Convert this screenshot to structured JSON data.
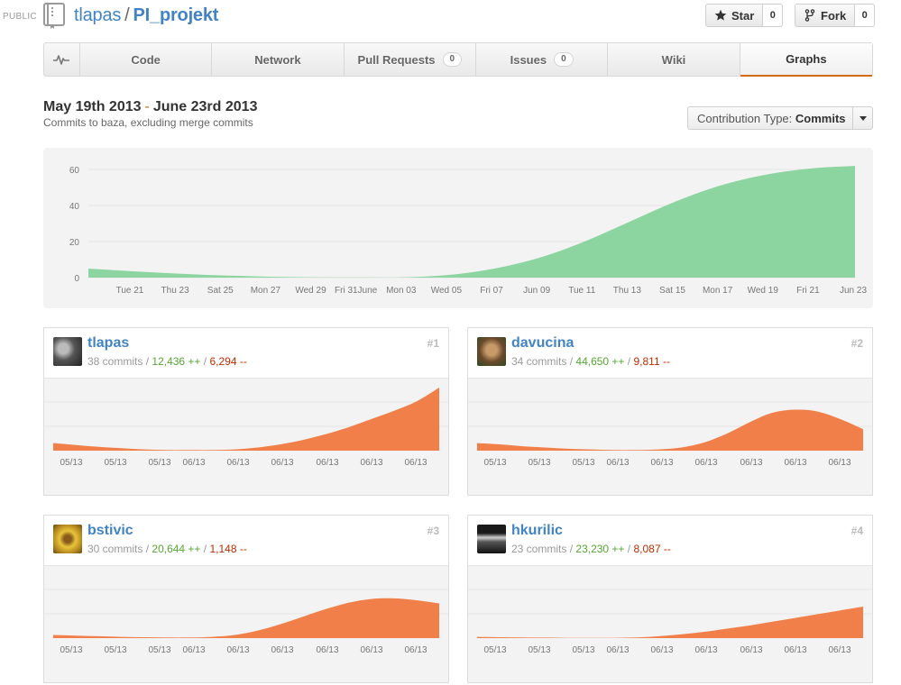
{
  "header": {
    "visibility": "PUBLIC",
    "owner": "tlapas",
    "separator": "/",
    "repo": "PI_projekt",
    "star_label": "Star",
    "star_count": "0",
    "fork_label": "Fork",
    "fork_count": "0"
  },
  "tabs": [
    {
      "label": "",
      "icon": "pulse-icon"
    },
    {
      "label": "Code"
    },
    {
      "label": "Network"
    },
    {
      "label": "Pull Requests",
      "count": "0"
    },
    {
      "label": "Issues",
      "count": "0"
    },
    {
      "label": "Wiki"
    },
    {
      "label": "Graphs",
      "active": true
    }
  ],
  "range": {
    "start": "May 19th 2013",
    "dash": "-",
    "end": "June 23rd 2013",
    "subtitle": "Commits to baza, excluding merge commits"
  },
  "contribution_type": {
    "label": "Contribution Type:",
    "value": "Commits"
  },
  "colors": {
    "main_area": "#8dd5a0",
    "contrib_area": "#f17f49",
    "link": "#4183c4",
    "additions": "#55a532",
    "deletions": "#bd2c00",
    "active_tab_border": "#d26911"
  },
  "chart_data": [
    {
      "type": "area",
      "yticks": [
        0,
        20,
        40,
        60
      ],
      "ylim": [
        0,
        62
      ],
      "xticks": [
        "Tue 21",
        "Thu 23",
        "Sat 25",
        "Mon 27",
        "Wed 29",
        "Fri 31June",
        "Mon 03",
        "Wed 05",
        "Fri 07",
        "Jun 09",
        "Tue 11",
        "Thu 13",
        "Sat 15",
        "Mon 17",
        "Wed 19",
        "Fri 21",
        "Jun 23"
      ],
      "x": [
        0,
        2,
        4,
        6,
        8,
        10,
        12,
        14,
        16,
        18,
        20,
        22,
        24,
        26,
        28,
        30,
        32,
        34
      ],
      "values": [
        5,
        3.5,
        2.2,
        1.2,
        0.5,
        0.2,
        0.1,
        0.2,
        1.5,
        5,
        11,
        20,
        31,
        42,
        51,
        57,
        60.5,
        62
      ]
    },
    {
      "type": "area",
      "contributor": "tlapas",
      "xticks": [
        "05/13",
        "05/13",
        "05/13",
        "06/13",
        "06/13",
        "06/13",
        "06/13",
        "06/13",
        "06/13"
      ],
      "values": [
        0.12,
        0.09,
        0.06,
        0.04,
        0.02,
        0.01,
        0.01,
        0.01,
        0.02,
        0.05,
        0.1,
        0.17,
        0.26,
        0.37,
        0.5,
        0.63,
        0.78,
        1.0
      ]
    },
    {
      "type": "area",
      "contributor": "davucina",
      "xticks": [
        "05/13",
        "05/13",
        "05/13",
        "06/13",
        "06/13",
        "06/13",
        "06/13",
        "06/13",
        "06/13"
      ],
      "values": [
        0.12,
        0.1,
        0.07,
        0.05,
        0.03,
        0.02,
        0.01,
        0.01,
        0.02,
        0.05,
        0.13,
        0.27,
        0.45,
        0.6,
        0.65,
        0.62,
        0.5,
        0.34
      ]
    },
    {
      "type": "area",
      "contributor": "bstivic",
      "xticks": [
        "05/13",
        "05/13",
        "05/13",
        "06/13",
        "06/13",
        "06/13",
        "06/13",
        "06/13",
        "06/13"
      ],
      "values": [
        0.05,
        0.04,
        0.03,
        0.02,
        0.015,
        0.01,
        0.01,
        0.02,
        0.05,
        0.12,
        0.22,
        0.34,
        0.46,
        0.56,
        0.62,
        0.63,
        0.6,
        0.55
      ]
    },
    {
      "type": "area",
      "contributor": "hkurilic",
      "xticks": [
        "05/13",
        "05/13",
        "05/13",
        "06/13",
        "06/13",
        "06/13",
        "06/13",
        "06/13",
        "06/13"
      ],
      "values": [
        0.02,
        0.015,
        0.01,
        0.008,
        0.005,
        0.005,
        0.005,
        0.01,
        0.03,
        0.06,
        0.1,
        0.15,
        0.2,
        0.26,
        0.32,
        0.38,
        0.44,
        0.5
      ]
    }
  ],
  "contributors": [
    {
      "username": "tlapas",
      "commits": "38 commits",
      "sep1": "/",
      "additions": "12,436 ++",
      "sep2": "/",
      "deletions": "6,294 --",
      "rank": "#1"
    },
    {
      "username": "davucina",
      "commits": "34 commits",
      "sep1": "/",
      "additions": "44,650 ++",
      "sep2": "/",
      "deletions": "9,811 --",
      "rank": "#2"
    },
    {
      "username": "bstivic",
      "commits": "30 commits",
      "sep1": "/",
      "additions": "20,644 ++",
      "sep2": "/",
      "deletions": "1,148 --",
      "rank": "#3"
    },
    {
      "username": "hkurilic",
      "commits": "23 commits",
      "sep1": "/",
      "additions": "23,230 ++",
      "sep2": "/",
      "deletions": "8,087 --",
      "rank": "#4"
    }
  ]
}
